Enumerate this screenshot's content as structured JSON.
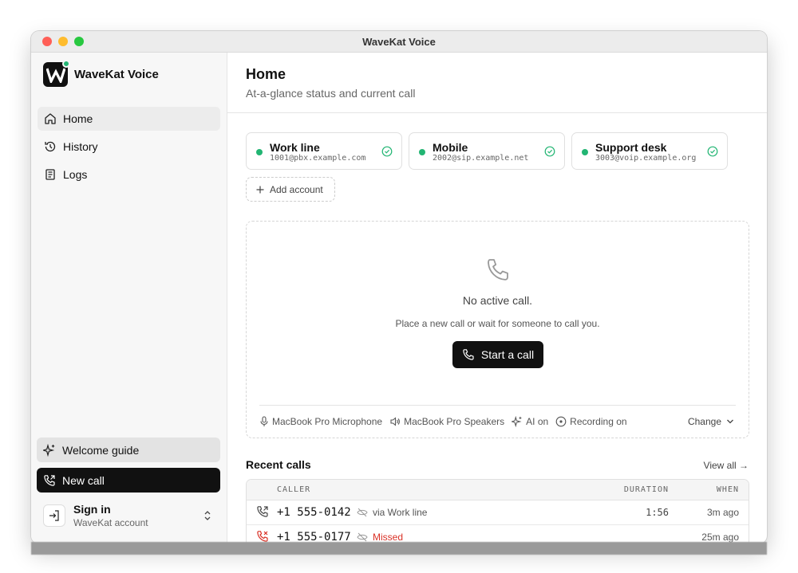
{
  "window": {
    "title": "WaveKat Voice"
  },
  "sidebar": {
    "brand": "WaveKat Voice",
    "nav": [
      {
        "label": "Home",
        "icon": "home-icon"
      },
      {
        "label": "History",
        "icon": "history-icon"
      },
      {
        "label": "Logs",
        "icon": "logs-icon"
      }
    ],
    "welcome_guide": "Welcome guide",
    "new_call": "New call",
    "signin": {
      "title": "Sign in",
      "subtitle": "WaveKat account"
    }
  },
  "header": {
    "title": "Home",
    "subtitle": "At-a-glance status and current call"
  },
  "accounts": [
    {
      "name": "Work line",
      "address": "1001@pbx.example.com"
    },
    {
      "name": "Mobile",
      "address": "2002@sip.example.net"
    },
    {
      "name": "Support desk",
      "address": "3003@voip.example.org"
    }
  ],
  "add_account": "Add account",
  "call_panel": {
    "status": "No active call.",
    "hint": "Place a new call or wait for someone to call you.",
    "start_button": "Start a call",
    "devices": {
      "microphone": "MacBook Pro Microphone",
      "speakers": "MacBook Pro Speakers",
      "ai": "AI on",
      "recording": "Recording on"
    },
    "change": "Change"
  },
  "recent": {
    "title": "Recent calls",
    "view_all": "View all →",
    "columns": {
      "caller": "CALLER",
      "duration": "DURATION",
      "when": "WHEN"
    },
    "rows": [
      {
        "number": "+1 555-0142",
        "via": "via Work line",
        "duration": "1:56",
        "when": "3m ago",
        "missed": false
      },
      {
        "number": "+1 555-0177",
        "via": "Missed",
        "duration": "",
        "when": "25m ago",
        "missed": true
      }
    ]
  },
  "colors": {
    "accent_green": "#22b573",
    "missed_red": "#d93025",
    "primary_dark": "#111111"
  }
}
